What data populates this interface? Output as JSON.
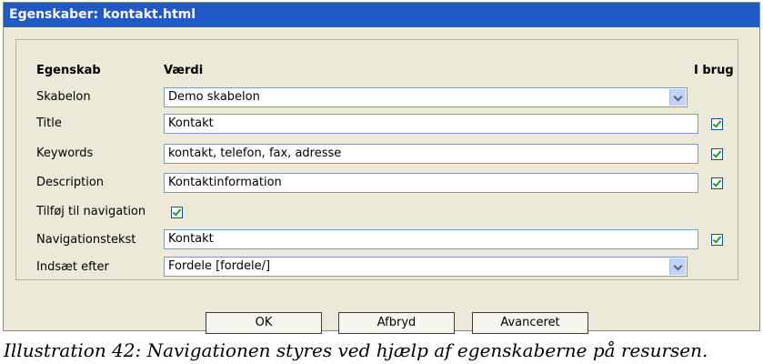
{
  "window": {
    "title": "Egenskaber: kontakt.html"
  },
  "headers": {
    "property": "Egenskab",
    "value": "Værdi",
    "in_use": "I brug"
  },
  "rows": {
    "template": {
      "label": "Skabelon",
      "value": "Demo skabelon"
    },
    "title": {
      "label": "Title",
      "value": "Kontakt",
      "in_use": true
    },
    "keywords": {
      "label": "Keywords",
      "value": "kontakt, telefon, fax, adresse",
      "in_use": true
    },
    "description": {
      "label": "Description",
      "value": "Kontaktinformation",
      "in_use": true
    },
    "add_to_nav": {
      "label": "Tilføj til navigation",
      "checked": true
    },
    "nav_text": {
      "label": "Navigationstekst",
      "value": "Kontakt",
      "in_use": true
    },
    "insert_after": {
      "label": "Indsæt efter",
      "value": "Fordele [fordele/]"
    }
  },
  "buttons": {
    "ok": "OK",
    "cancel": "Afbryd",
    "advanced": "Avanceret"
  },
  "caption": "Illustration 42: Navigationen styres ved hjælp af egenskaberne på resursen.",
  "colors": {
    "titlebar": "#2259c8",
    "dialog_bg": "#ece9d8",
    "check": "#21a121"
  }
}
